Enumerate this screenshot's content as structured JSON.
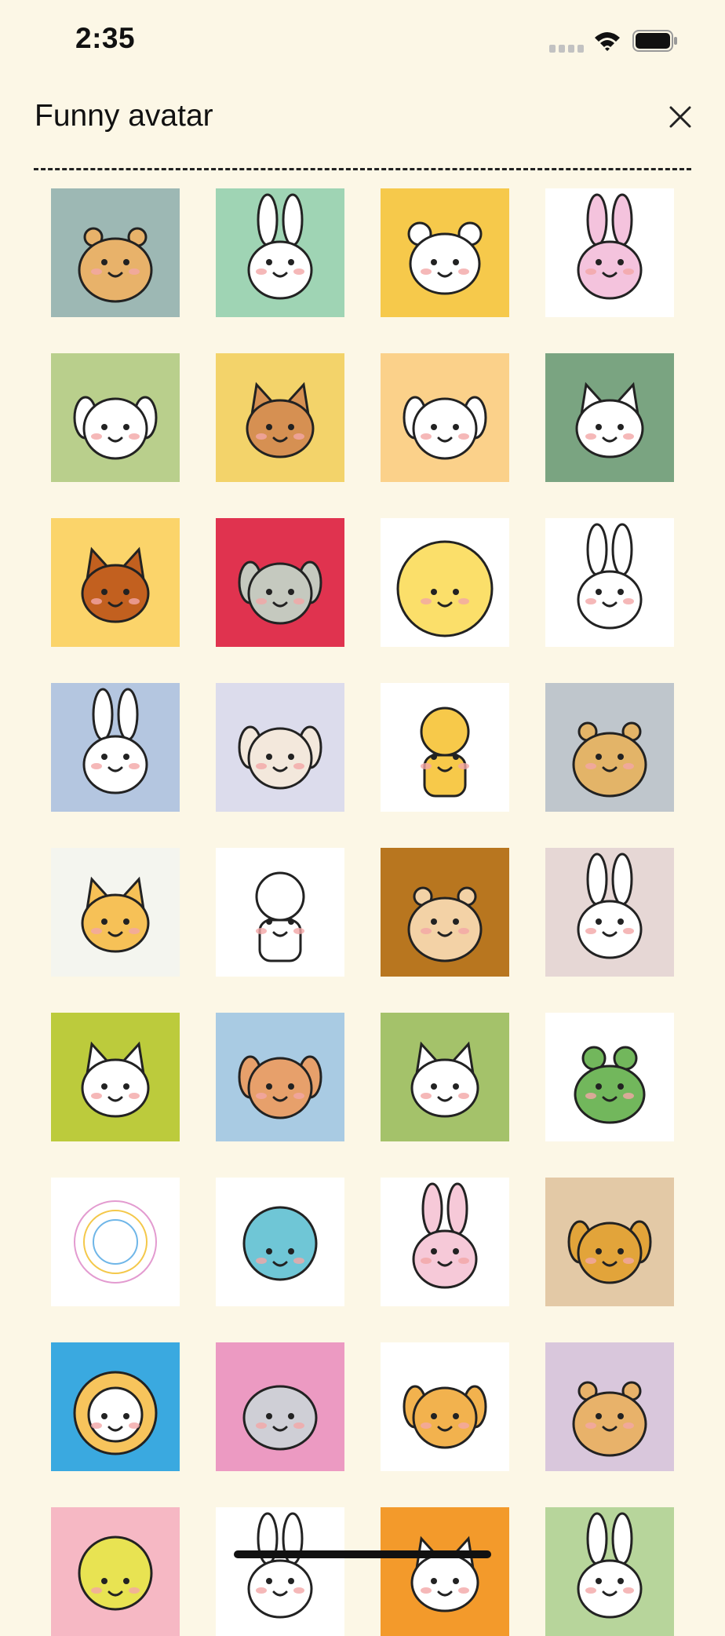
{
  "status_bar": {
    "time": "2:35"
  },
  "header": {
    "title": "Funny avatar"
  },
  "avatars": [
    {
      "name": "avatar-hamster-flower",
      "bg": "#9db8b4",
      "accent": "#e8b26a",
      "character": "hamster"
    },
    {
      "name": "avatar-bunny-scooter",
      "bg": "#9fd4b4",
      "accent": "#ffffff",
      "character": "bunny"
    },
    {
      "name": "avatar-bear-sunburst",
      "bg": "#f6c94b",
      "accent": "#ffffff",
      "character": "bear"
    },
    {
      "name": "avatar-pink-bunny-sunglasses",
      "bg": "#ffffff",
      "accent": "#f4c3dd",
      "character": "bunny"
    },
    {
      "name": "avatar-shiba-dog",
      "bg": "#b9cf8c",
      "accent": "#ffffff",
      "character": "dog"
    },
    {
      "name": "avatar-brown-cat-sunburst",
      "bg": "#f3d36a",
      "accent": "#d69052",
      "character": "cat"
    },
    {
      "name": "avatar-fluffy-dog-grin",
      "bg": "#fbd18a",
      "accent": "#ffffff",
      "character": "dog"
    },
    {
      "name": "avatar-muscle-cat-selfie",
      "bg": "#7aa481",
      "accent": "#ffffff",
      "character": "cat"
    },
    {
      "name": "avatar-orange-cat",
      "bg": "#fbd46a",
      "accent": "#c2601f",
      "character": "cat"
    },
    {
      "name": "avatar-cool-schnauzer",
      "bg": "#e0334f",
      "accent": "#c5c9bf",
      "character": "dog"
    },
    {
      "name": "avatar-yellow-chick",
      "bg": "#ffffff",
      "accent": "#fbdf6a",
      "character": "chick"
    },
    {
      "name": "avatar-bunny-hands",
      "bg": "#ffffff",
      "accent": "#ffffff",
      "character": "bunny"
    },
    {
      "name": "avatar-bunny-bed-phone",
      "bg": "#b4c6e0",
      "accent": "#ffffff",
      "character": "bunny"
    },
    {
      "name": "avatar-sleepy-dog-laptop",
      "bg": "#dcdcec",
      "accent": "#f3e8dc",
      "character": "dog"
    },
    {
      "name": "avatar-rainbow-dancer",
      "bg": "#ffffff",
      "accent": "#f7c94a",
      "character": "person"
    },
    {
      "name": "avatar-hamster-fish",
      "bg": "#bfc6cc",
      "accent": "#e3b468",
      "character": "hamster"
    },
    {
      "name": "avatar-cat-eating",
      "bg": "#f4f5ef",
      "accent": "#f6c157",
      "character": "cat"
    },
    {
      "name": "avatar-shark-girl",
      "bg": "#ffffff",
      "accent": "#ffffff",
      "character": "person"
    },
    {
      "name": "avatar-hamster-acorn",
      "bg": "#b8761f",
      "accent": "#f3d2a6",
      "character": "hamster"
    },
    {
      "name": "avatar-bunny-blush",
      "bg": "#e6d7d5",
      "accent": "#ffffff",
      "character": "bunny"
    },
    {
      "name": "avatar-cat-mug",
      "bg": "#bccb3c",
      "accent": "#ffffff",
      "character": "cat"
    },
    {
      "name": "avatar-corgi-suitcase",
      "bg": "#a9cbe3",
      "accent": "#e7a06b",
      "character": "dog"
    },
    {
      "name": "avatar-cat-fish-dinner",
      "bg": "#a4c26a",
      "accent": "#ffffff",
      "character": "cat"
    },
    {
      "name": "avatar-frog-party",
      "bg": "#ffffff",
      "accent": "#72b75c",
      "character": "frog"
    },
    {
      "name": "avatar-scribble-circle",
      "bg": "#ffffff",
      "accent": "#ffffff",
      "character": "scribble"
    },
    {
      "name": "avatar-fish-monster",
      "bg": "#ffffff",
      "accent": "#6fc6d6",
      "character": "monster"
    },
    {
      "name": "avatar-pink-bunny-laptop",
      "bg": "#ffffff",
      "accent": "#f6c9d8",
      "character": "bunny"
    },
    {
      "name": "avatar-dog-bed-phone",
      "bg": "#e3c9a6",
      "accent": "#e2a43a",
      "character": "dog"
    },
    {
      "name": "avatar-lion-window",
      "bg": "#3aa9e0",
      "accent": "#f7c45c",
      "character": "lion"
    },
    {
      "name": "avatar-hippo-bed",
      "bg": "#ec9ac2",
      "accent": "#f7e26d",
      "character": "hippo"
    },
    {
      "name": "avatar-dog-fries",
      "bg": "#ffffff",
      "accent": "#f2b24e",
      "character": "dog"
    },
    {
      "name": "avatar-hamster-purple",
      "bg": "#d9c7dc",
      "accent": "#e8b26a",
      "character": "hamster"
    },
    {
      "name": "avatar-yellow-monster",
      "bg": "#f6b8c4",
      "accent": "#e8e352",
      "character": "monster"
    },
    {
      "name": "avatar-bunny-black",
      "bg": "#ffffff",
      "accent": "#ffffff",
      "character": "bunny"
    },
    {
      "name": "avatar-white-cat-orange",
      "bg": "#f39a2b",
      "accent": "#ffffff",
      "character": "cat"
    },
    {
      "name": "avatar-bunny-sky",
      "bg": "#b7d59b",
      "accent": "#ffffff",
      "character": "bunny"
    }
  ]
}
